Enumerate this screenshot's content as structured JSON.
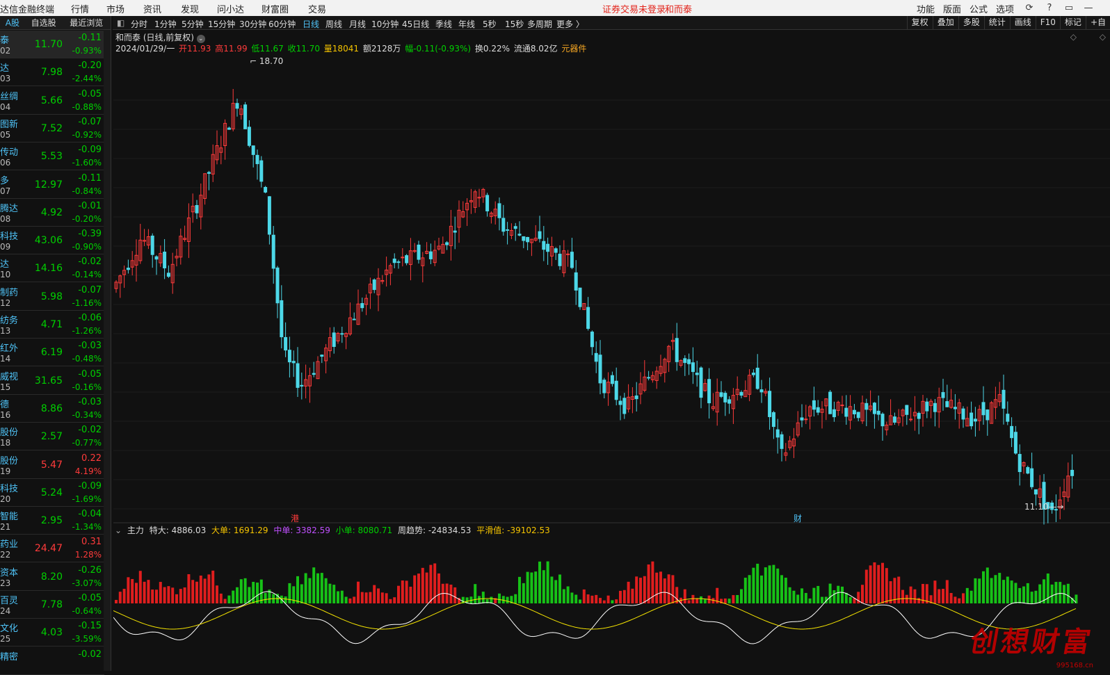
{
  "menubar": {
    "app": "达信金融终端",
    "items": [
      "行情",
      "市场",
      "资讯",
      "发现",
      "问小达",
      "财富圈",
      "交易"
    ],
    "notice": "证券交易未登录",
    "stock": "和而泰",
    "right": [
      "功能",
      "版面",
      "公式",
      "选项"
    ]
  },
  "left_tabs": [
    "A股",
    "自选股",
    "最近浏览"
  ],
  "stocks": [
    {
      "name": "泰",
      "code": "02",
      "price": "11.70",
      "chg": "-0.11",
      "pct": "-0.93%",
      "dir": "dn"
    },
    {
      "name": "达",
      "code": "03",
      "price": "7.98",
      "chg": "-0.20",
      "pct": "-2.44%",
      "dir": "dn"
    },
    {
      "name": "丝绸",
      "code": "04",
      "price": "5.66",
      "chg": "-0.05",
      "pct": "-0.88%",
      "dir": "dn"
    },
    {
      "name": "图新",
      "code": "05",
      "price": "7.52",
      "chg": "-0.07",
      "pct": "-0.92%",
      "dir": "dn"
    },
    {
      "name": "传动",
      "code": "06",
      "price": "5.53",
      "chg": "-0.09",
      "pct": "-1.60%",
      "dir": "dn"
    },
    {
      "name": "多",
      "code": "07",
      "price": "12.97",
      "chg": "-0.11",
      "pct": "-0.84%",
      "dir": "dn"
    },
    {
      "name": "腾达",
      "code": "08",
      "price": "4.92",
      "chg": "-0.01",
      "pct": "-0.20%",
      "dir": "dn"
    },
    {
      "name": "科技",
      "code": "09",
      "price": "43.06",
      "chg": "-0.39",
      "pct": "-0.90%",
      "dir": "dn"
    },
    {
      "name": "达",
      "code": "10",
      "price": "14.16",
      "chg": "-0.02",
      "pct": "-0.14%",
      "dir": "dn"
    },
    {
      "name": "制药",
      "code": "12",
      "price": "5.98",
      "chg": "-0.07",
      "pct": "-1.16%",
      "dir": "dn"
    },
    {
      "name": "纺务",
      "code": "13",
      "price": "4.71",
      "chg": "-0.06",
      "pct": "-1.26%",
      "dir": "dn"
    },
    {
      "name": "红外",
      "code": "14",
      "price": "6.19",
      "chg": "-0.03",
      "pct": "-0.48%",
      "dir": "dn"
    },
    {
      "name": "威视",
      "code": "15",
      "price": "31.65",
      "chg": "-0.05",
      "pct": "-0.16%",
      "dir": "dn"
    },
    {
      "name": "德",
      "code": "16",
      "price": "8.86",
      "chg": "-0.03",
      "pct": "-0.34%",
      "dir": "dn"
    },
    {
      "name": "股份",
      "code": "18",
      "price": "2.57",
      "chg": "-0.02",
      "pct": "-0.77%",
      "dir": "dn"
    },
    {
      "name": "股份",
      "code": "19",
      "price": "5.47",
      "chg": "0.22",
      "pct": "4.19%",
      "dir": "up"
    },
    {
      "name": "科技",
      "code": "20",
      "price": "5.24",
      "chg": "-0.09",
      "pct": "-1.69%",
      "dir": "dn"
    },
    {
      "name": "智能",
      "code": "21",
      "price": "2.95",
      "chg": "-0.04",
      "pct": "-1.34%",
      "dir": "dn"
    },
    {
      "name": "药业",
      "code": "22",
      "price": "24.47",
      "chg": "0.31",
      "pct": "1.28%",
      "dir": "up"
    },
    {
      "name": "资本",
      "code": "23",
      "price": "8.20",
      "chg": "-0.26",
      "pct": "-3.07%",
      "dir": "dn"
    },
    {
      "name": "百灵",
      "code": "24",
      "price": "7.78",
      "chg": "-0.05",
      "pct": "-0.64%",
      "dir": "dn"
    },
    {
      "name": "文化",
      "code": "25",
      "price": "4.03",
      "chg": "-0.15",
      "pct": "-3.59%",
      "dir": "dn"
    },
    {
      "name": "精密",
      "code": "",
      "price": "",
      "chg": "-0.02",
      "pct": "",
      "dir": "dn"
    }
  ],
  "periods": [
    "分时",
    "1分钟",
    "5分钟",
    "15分钟",
    "30分钟",
    "60分钟",
    "日线",
    "周线",
    "月线",
    "10分钟",
    "45日线",
    "季线",
    "年线",
    "5秒",
    "15秒",
    "多周期",
    "更多 〉"
  ],
  "active_period": "日线",
  "right_tools": [
    "复权",
    "叠加",
    "多股",
    "统计",
    "画线",
    "F10",
    "标记",
    "+自"
  ],
  "chart_title": "和而泰 (日线,前复权)",
  "quote": {
    "date": "2024/01/29/一",
    "open": "开11.93",
    "high": "高11.99",
    "low": "低11.67",
    "close": "收11.70",
    "vol": "量18041",
    "amt": "额2128万",
    "amp": "幅-0.11(-0.93%)",
    "turn": "换0.22%",
    "float": "流通8.02亿",
    "concept": "元器件"
  },
  "marks": {
    "high": "18.70",
    "low": "11.10",
    "gang": "港",
    "cai": "财"
  },
  "indicator": {
    "name": "主力",
    "tedа": "特大: 4886.03",
    "large": "大单: 1691.29",
    "mid": "中单: 3382.59",
    "small": "小单: 8080.71",
    "trend": "周趋势: -24834.53",
    "smooth": "平滑值: -39102.53"
  },
  "watermark": {
    "text": "创想财富",
    "site": "995168.cn"
  },
  "chart_data": {
    "type": "candlestick",
    "high": 18.7,
    "low": 11.1,
    "last_close": 11.7,
    "colors": {
      "up": "#ff3b3b",
      "down": "#4dd8e8"
    }
  }
}
